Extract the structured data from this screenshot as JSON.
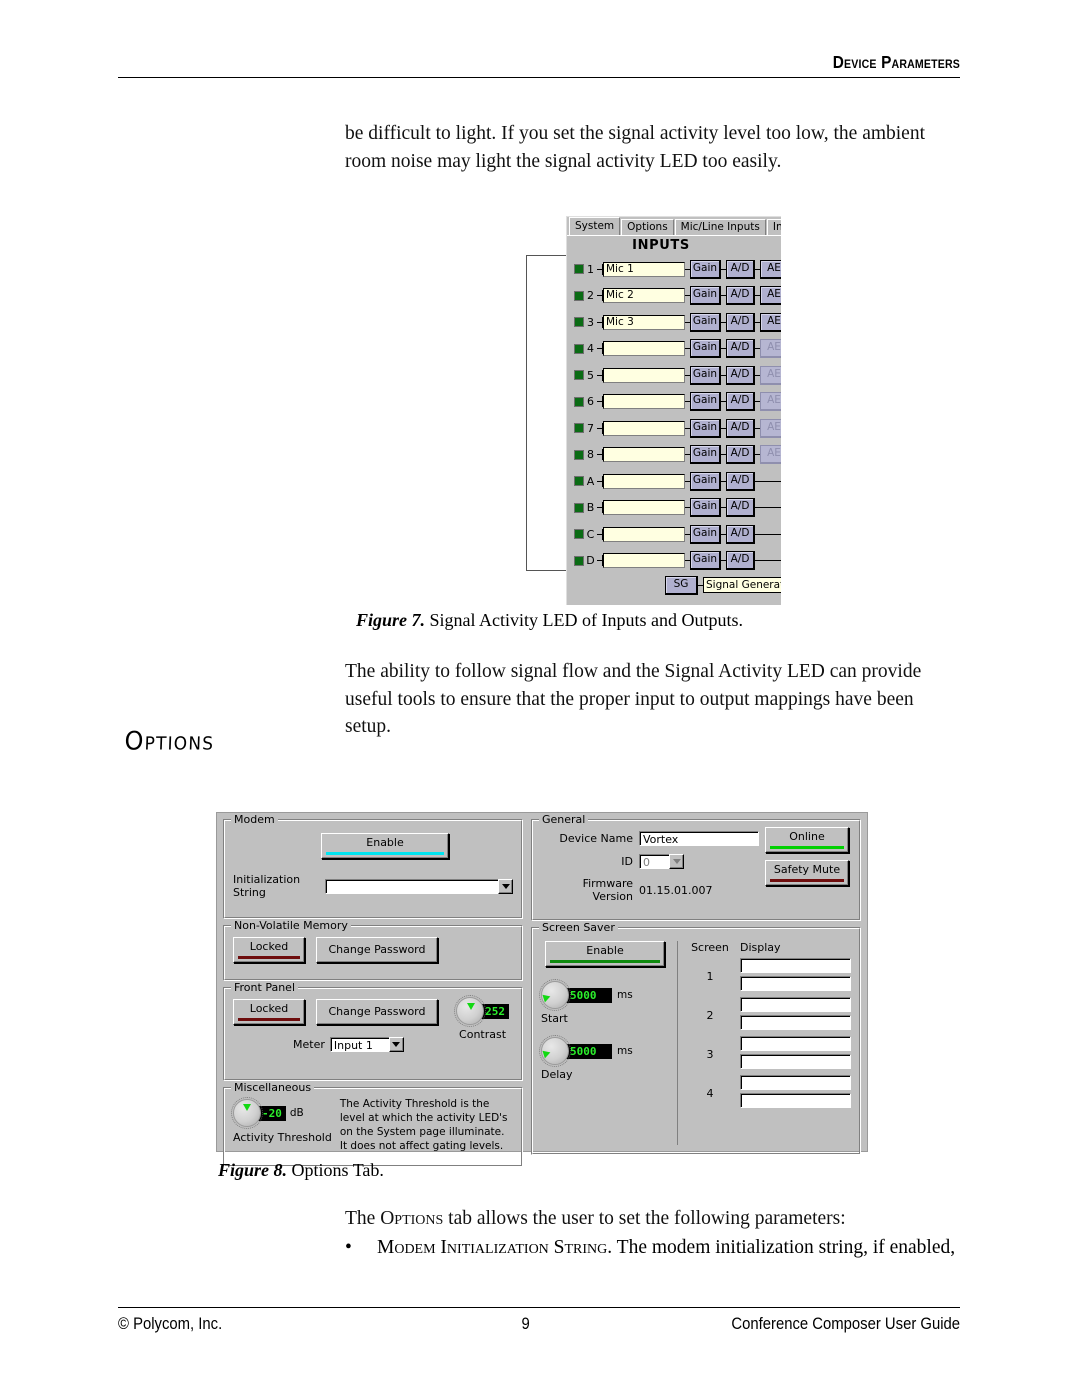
{
  "header": {
    "title": "Device Parameters"
  },
  "paragraphs": {
    "p1": "be difficult to light.  If you set the signal activity level too low, the ambient room noise may light the signal activity LED too easily.",
    "p2": "The ability to follow signal flow and the Signal Activity LED can provide useful tools to ensure that the proper input to output mappings have been setup.",
    "p3_pre": "The ",
    "p3_sc": "Options",
    "p3_post": " tab allows the user to set the following parameters:"
  },
  "section_heading": "Options",
  "figure7": {
    "caption_label": "Figure 7.",
    "caption_text": "Signal Activity LED of Inputs and Outputs.",
    "tabs": [
      {
        "label": "System",
        "active": true
      },
      {
        "label": "Options",
        "active": false
      },
      {
        "label": "Mic/Line Inputs",
        "active": false
      },
      {
        "label": "Input F",
        "active": false
      }
    ],
    "panel_title": "INPUTS",
    "block_gain": "Gain",
    "block_ad": "A/D",
    "block_aec": "AE",
    "rows": [
      {
        "channel": "1",
        "name": "Mic 1",
        "aec": "on"
      },
      {
        "channel": "2",
        "name": "Mic 2",
        "aec": "on"
      },
      {
        "channel": "3",
        "name": "Mic 3",
        "aec": "on"
      },
      {
        "channel": "4",
        "name": "",
        "aec": "dim"
      },
      {
        "channel": "5",
        "name": "",
        "aec": "dim"
      },
      {
        "channel": "6",
        "name": "",
        "aec": "dim"
      },
      {
        "channel": "7",
        "name": "",
        "aec": "dim"
      },
      {
        "channel": "8",
        "name": "",
        "aec": "dim"
      },
      {
        "channel": "A",
        "name": "",
        "aec": "none"
      },
      {
        "channel": "B",
        "name": "",
        "aec": "none"
      },
      {
        "channel": "C",
        "name": "",
        "aec": "none"
      },
      {
        "channel": "D",
        "name": "",
        "aec": "none"
      }
    ],
    "signal_generator": {
      "button": "SG",
      "label": "Signal Generator"
    }
  },
  "figure8": {
    "caption_label": "Figure 8.",
    "caption_text": "Options Tab.",
    "modem": {
      "group_label": "Modem",
      "enable_label": "Enable",
      "enable_bar_color": "#00e5f0",
      "init_string_label": "Initialization String",
      "init_string_value": ""
    },
    "nvm": {
      "group_label": "Non-Volatile Memory",
      "locked_label": "Locked",
      "locked_bar_color": "#6e0d0d",
      "change_password_label": "Change Password"
    },
    "front_panel": {
      "group_label": "Front Panel",
      "locked_label": "Locked",
      "locked_bar_color": "#6e0d0d",
      "change_password_label": "Change Password",
      "meter_label": "Meter",
      "meter_value": "Input 1",
      "contrast_label": "Contrast",
      "contrast_value": "252"
    },
    "miscellaneous": {
      "group_label": "Miscellaneous",
      "activity_threshold_label": "Activity Threshold",
      "activity_threshold_value": "-20",
      "activity_threshold_unit": "dB",
      "help_text": "The Activity Threshold is the level at which the activity LED's on the System page illuminate. It does not affect gating levels."
    },
    "general": {
      "group_label": "General",
      "device_name_label": "Device Name",
      "device_name_value": "Vortex",
      "id_label": "ID",
      "id_value": "0",
      "firmware_label": "Firmware Version",
      "firmware_value": "01.15.01.007",
      "online_label": "Online",
      "online_bar_color": "#00d000",
      "safety_mute_label": "Safety Mute",
      "safety_mute_bar_color": "#6e0d0d"
    },
    "screen_saver": {
      "group_label": "Screen Saver",
      "enable_label": "Enable",
      "enable_bar_color": "#0f8a0f",
      "start_label": "Start",
      "start_value": "5000",
      "start_unit": "ms",
      "delay_label": "Delay",
      "delay_value": "5000",
      "delay_unit": "ms",
      "screen_col_header": "Screen",
      "display_col_header": "Display",
      "screens": [
        {
          "num": "1",
          "line1": "",
          "line2": ""
        },
        {
          "num": "2",
          "line1": "",
          "line2": ""
        },
        {
          "num": "3",
          "line1": "",
          "line2": ""
        },
        {
          "num": "4",
          "line1": "",
          "line2": ""
        }
      ]
    }
  },
  "bullets": [
    {
      "dot": "•",
      "sc": "Modem Initialization String.",
      "text": "  The modem initialization string, if enabled,"
    }
  ],
  "footer": {
    "left": "© Polycom, Inc.",
    "page_number": "9",
    "right": "Conference Composer User Guide"
  }
}
